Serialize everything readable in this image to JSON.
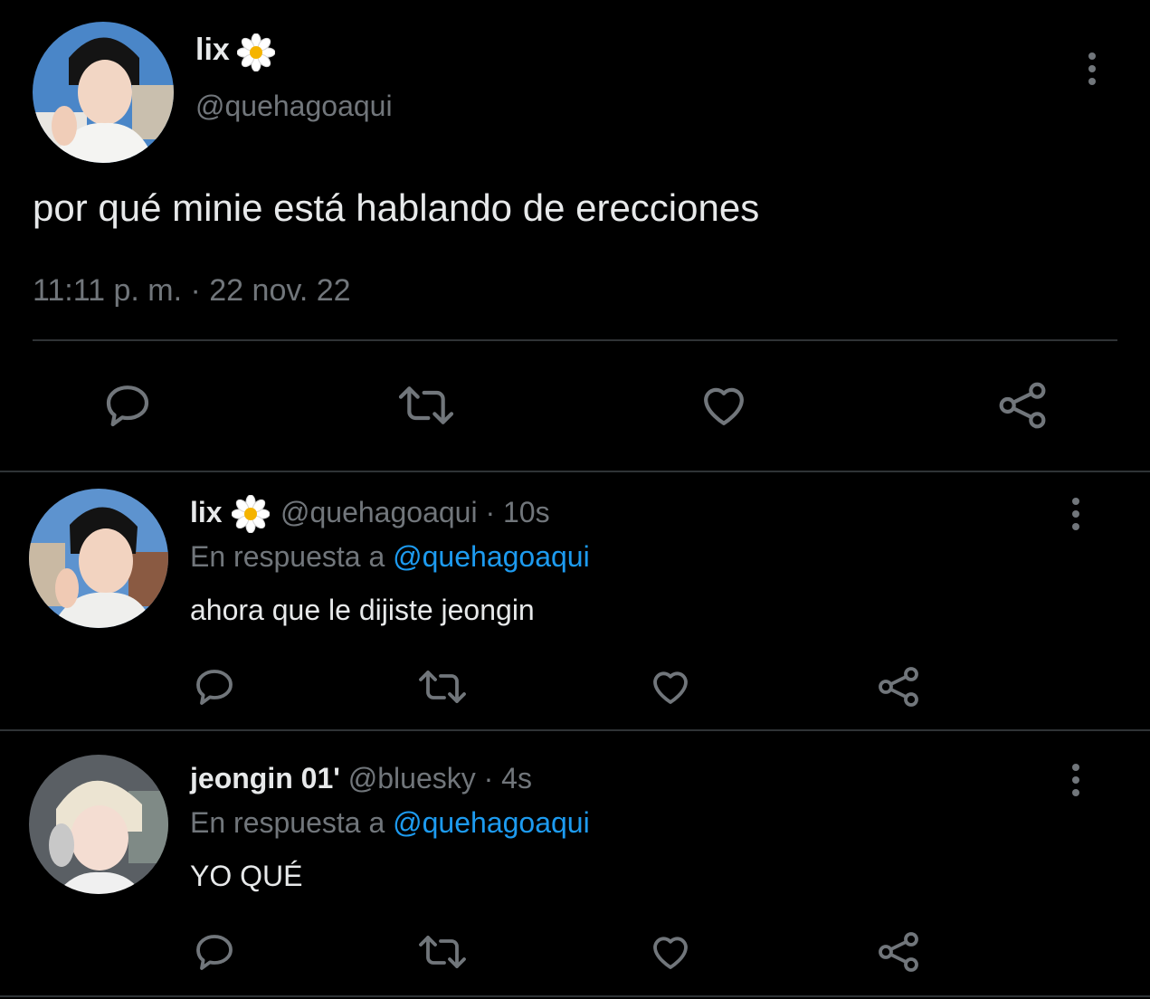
{
  "main_tweet": {
    "display_name": "lix",
    "emoji": "🌼",
    "handle": "@quehagoaqui",
    "text": "por qué minie está hablando de erecciones",
    "timestamp": "11:11 p. m. · 22 nov. 22"
  },
  "replies": [
    {
      "display_name": "lix",
      "emoji": "🌼",
      "handle": "@quehagoaqui",
      "time": "· 10s",
      "reply_prefix": "En respuesta a",
      "reply_to": "@quehagoaqui",
      "text": "ahora que le dijiste jeongin"
    },
    {
      "display_name": "jeongin 01'",
      "handle": "@bluesky",
      "time": "· 4s",
      "reply_prefix": "En respuesta a",
      "reply_to": "@quehagoaqui",
      "text": "YO QUÉ"
    }
  ],
  "icons": {
    "reply": "reply-icon",
    "retweet": "retweet-icon",
    "like": "heart-icon",
    "share": "share-icon",
    "more": "more-options-icon"
  },
  "colors": {
    "background": "#000000",
    "text": "#e7e9ea",
    "muted": "#71767b",
    "link": "#1d9bf0",
    "divider": "#2f3336"
  }
}
